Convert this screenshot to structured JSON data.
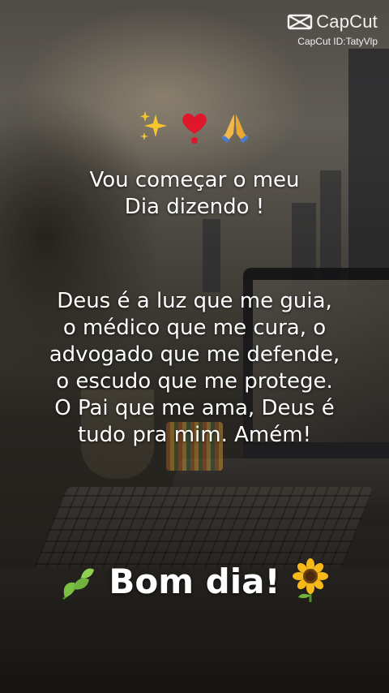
{
  "watermark": {
    "brand": "CapCut",
    "user_id": "CapCut ID:TatyVlp"
  },
  "top_emojis": [
    "sparkles-icon",
    "heart-icon",
    "praying-hands-icon"
  ],
  "intro_text": "Vou começar o meu\nDia dizendo !",
  "prayer_text": "Deus é a luz que me guia,\no médico que me cura, o\nadvogado que me defende,\no escudo que me protege.\nO Pai que me ama, Deus é\ntudo pra mim. Amém!",
  "greeting": {
    "text": "Bom dia!",
    "left_icon": "herb-icon",
    "right_icon": "sunflower-icon"
  },
  "colors": {
    "text": "#ffffff",
    "heart": "#e0162b",
    "sparkle": "#f7c62f",
    "sunflower_petals": "#f6b919",
    "leaf": "#6fb33c"
  }
}
